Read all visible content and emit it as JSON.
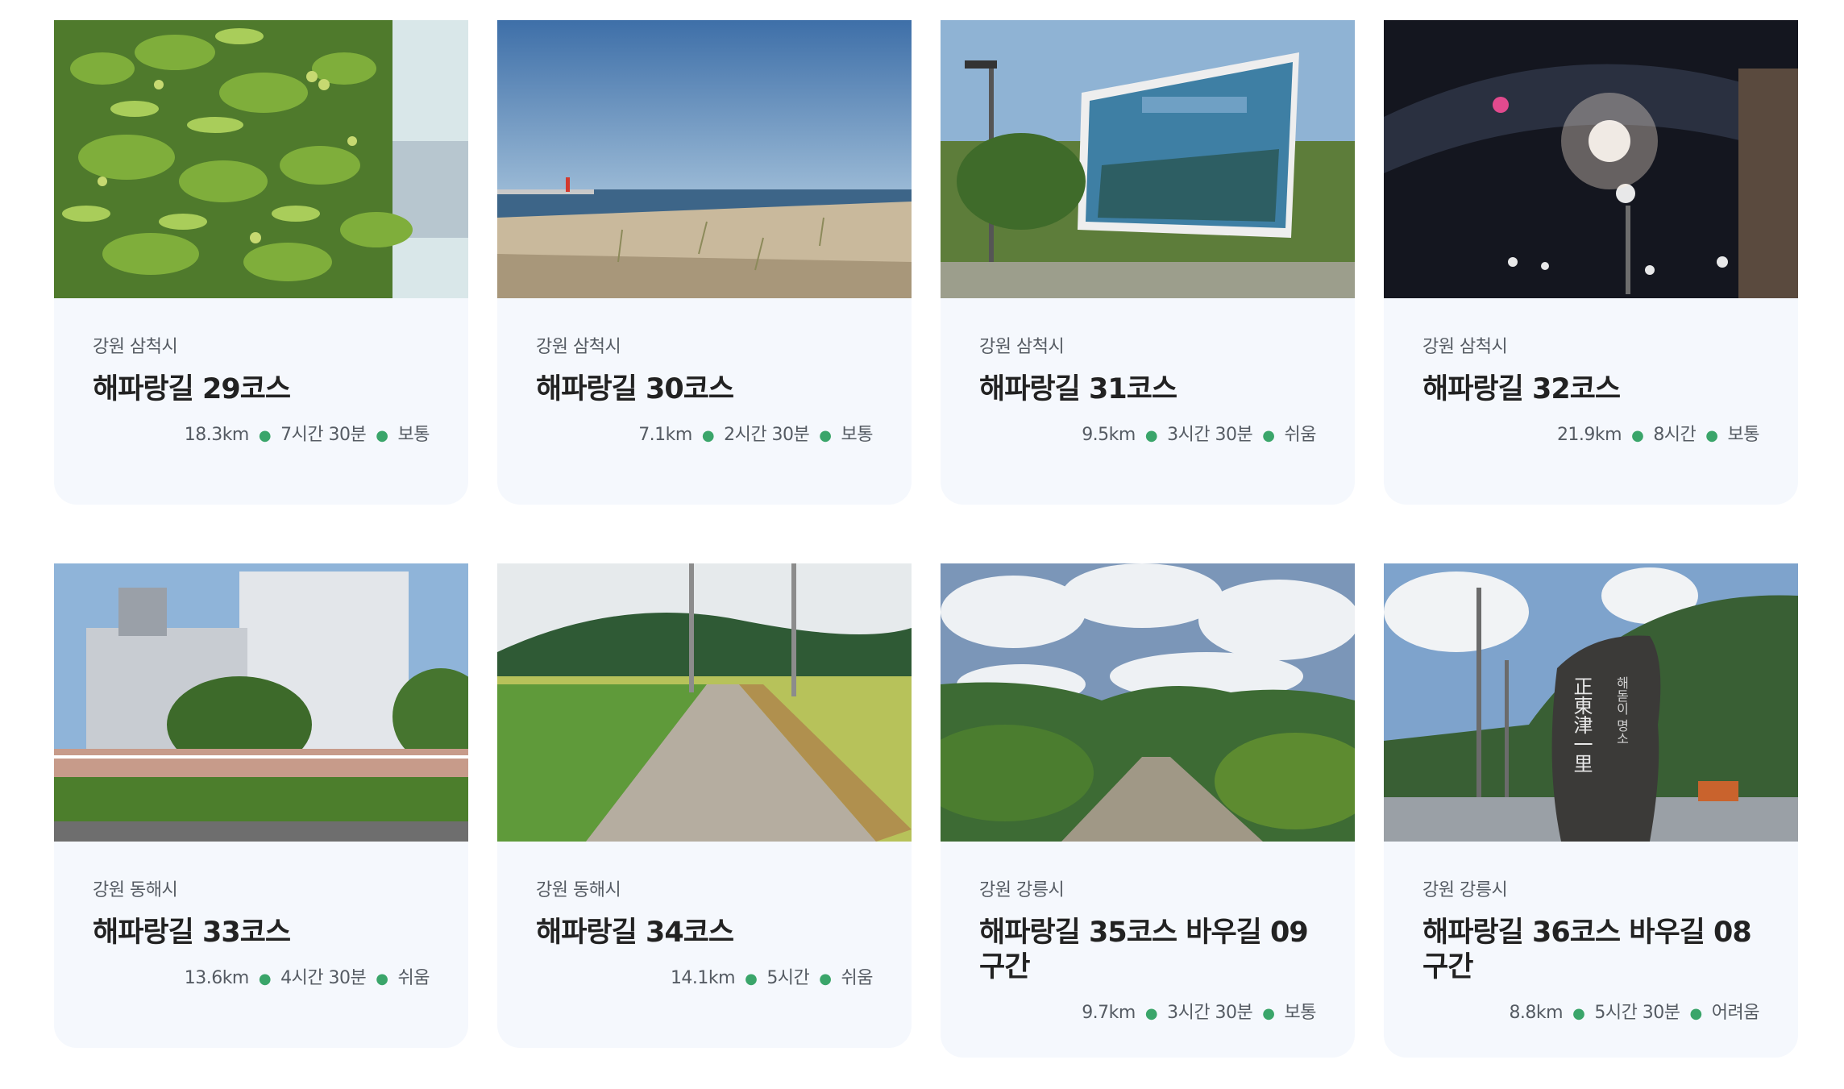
{
  "cards": [
    {
      "region": "강원 삼척시",
      "title": "해파랑길 29코스",
      "distance": "18.3km",
      "duration": "7시간 30분",
      "difficulty": "보통",
      "image": "jujube-tree-photo"
    },
    {
      "region": "강원 삼척시",
      "title": "해파랑길 30코스",
      "distance": "7.1km",
      "duration": "2시간 30분",
      "difficulty": "보통",
      "image": "sandy-beach-photo"
    },
    {
      "region": "강원 삼척시",
      "title": "해파랑길 31코스",
      "distance": "9.5km",
      "duration": "3시간 30분",
      "difficulty": "쉬움",
      "image": "village-billboard-photo"
    },
    {
      "region": "강원 삼척시",
      "title": "해파랑길 32코스",
      "distance": "21.9km",
      "duration": "8시간",
      "difficulty": "보통",
      "image": "night-gate-lights-photo"
    },
    {
      "region": "강원 동해시",
      "title": "해파랑길 33코스",
      "distance": "13.6km",
      "duration": "4시간 30분",
      "difficulty": "쉬움",
      "image": "factory-building-photo"
    },
    {
      "region": "강원 동해시",
      "title": "해파랑길 34코스",
      "distance": "14.1km",
      "duration": "5시간",
      "difficulty": "쉬움",
      "image": "rice-field-path-photo"
    },
    {
      "region": "강원 강릉시",
      "title": "해파랑길 35코스 바우길 09구간",
      "distance": "9.7km",
      "duration": "3시간 30분",
      "difficulty": "보통",
      "image": "mountain-road-photo"
    },
    {
      "region": "강원 강릉시",
      "title": "해파랑길 36코스 바우길 08구간",
      "distance": "8.8km",
      "duration": "5시간 30분",
      "difficulty": "어려움",
      "image": "jeongdongjin-stone-photo",
      "stone_text": "正東津一里",
      "stone_subtext": "해돋이 명소"
    }
  ],
  "colors": {
    "card_bg": "#f5f8fd",
    "dot": "#3aa56a",
    "title": "#222222",
    "meta": "#555b63"
  }
}
